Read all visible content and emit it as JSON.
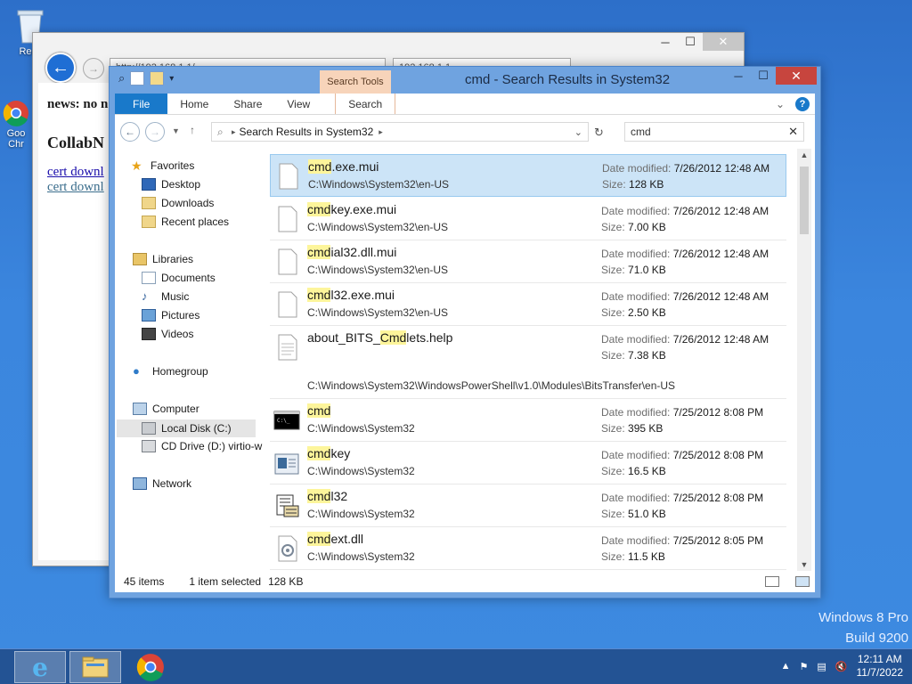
{
  "desktop": {
    "icons": [
      {
        "label": "Recy"
      },
      {
        "label": "Goo Chr"
      }
    ],
    "watermark": [
      "Windows 8 Pro",
      "Build 9200"
    ]
  },
  "browser": {
    "address": "http://192.168.1.1/",
    "tab_text": "192.168.1.1",
    "news": "news: no n",
    "heading": "CollabN",
    "links": [
      "cert downl",
      "cert downl"
    ]
  },
  "explorer": {
    "title": "cmd - Search Results in System32",
    "contextual_tab": "Search Tools",
    "tabs": {
      "file": "File",
      "home": "Home",
      "share": "Share",
      "view": "View",
      "search": "Search"
    },
    "path": "Search Results in System32",
    "search_value": "cmd",
    "nav": {
      "favorites": "Favorites",
      "desktop": "Desktop",
      "downloads": "Downloads",
      "recent": "Recent places",
      "libraries": "Libraries",
      "documents": "Documents",
      "music": "Music",
      "pictures": "Pictures",
      "videos": "Videos",
      "homegroup": "Homegroup",
      "computer": "Computer",
      "local_disk": "Local Disk (C:)",
      "cd_drive": "CD Drive (D:) virtio-w",
      "network": "Network"
    },
    "labels": {
      "date_modified": "Date modified:",
      "size": "Size:"
    },
    "results": [
      {
        "hl": "cmd",
        "rest": ".exe.mui",
        "path": "C:\\Windows\\System32\\en-US",
        "date": "7/26/2012 12:48 AM",
        "size": "128 KB"
      },
      {
        "hl": "cmd",
        "rest": "key.exe.mui",
        "path": "C:\\Windows\\System32\\en-US",
        "date": "7/26/2012 12:48 AM",
        "size": "7.00 KB"
      },
      {
        "hl": "cmd",
        "rest": "ial32.dll.mui",
        "path": "C:\\Windows\\System32\\en-US",
        "date": "7/26/2012 12:48 AM",
        "size": "71.0 KB"
      },
      {
        "hl": "cmd",
        "rest": "l32.exe.mui",
        "path": "C:\\Windows\\System32\\en-US",
        "date": "7/26/2012 12:48 AM",
        "size": "2.50 KB"
      },
      {
        "pre": "about_BITS_",
        "hl": "Cmd",
        "rest": "lets.help",
        "path": "C:\\Windows\\System32\\WindowsPowerShell\\v1.0\\Modules\\BitsTransfer\\en-US",
        "date": "7/26/2012 12:48 AM",
        "size": "7.38 KB"
      },
      {
        "hl": "cmd",
        "rest": "",
        "path": "C:\\Windows\\System32",
        "date": "7/25/2012 8:08 PM",
        "size": "395 KB"
      },
      {
        "hl": "cmd",
        "rest": "key",
        "path": "C:\\Windows\\System32",
        "date": "7/25/2012 8:08 PM",
        "size": "16.5 KB"
      },
      {
        "hl": "cmd",
        "rest": "l32",
        "path": "C:\\Windows\\System32",
        "date": "7/25/2012 8:08 PM",
        "size": "51.0 KB"
      },
      {
        "hl": "cmd",
        "rest": "ext.dll",
        "path": "C:\\Windows\\System32",
        "date": "7/25/2012 8:05 PM",
        "size": "11.5 KB"
      }
    ],
    "status": {
      "count": "45 items",
      "selected": "1 item selected",
      "size": "128 KB"
    }
  },
  "taskbar": {
    "time": "12:11 AM",
    "date": "11/7/2022"
  }
}
